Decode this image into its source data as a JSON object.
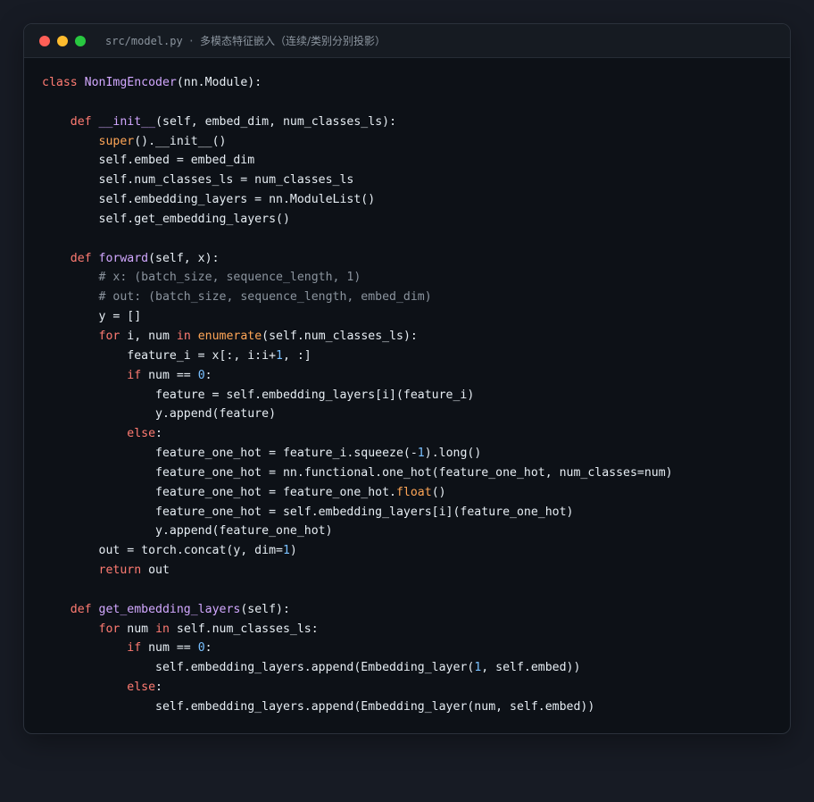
{
  "window": {
    "title_path": "src/model.py",
    "title_separator": "·",
    "title_desc": "多模态特征嵌入（连续/类别分别投影）",
    "traffic_lights": [
      {
        "name": "close",
        "color": "#ff5f57"
      },
      {
        "name": "minimize",
        "color": "#febc2e"
      },
      {
        "name": "maximize",
        "color": "#28c840"
      }
    ]
  },
  "colors": {
    "background": "#0d1117",
    "keyword": "#ff7b72",
    "class_name": "#d2a8ff",
    "function_name": "#d2a8ff",
    "builtin": "#ffa657",
    "number": "#79c0ff",
    "comment": "#8b949e",
    "text": "#e6edf3"
  },
  "code_lines": [
    [
      [
        "kw",
        "class "
      ],
      [
        "cls",
        "NonImgEncoder"
      ],
      [
        "",
        "(nn.Module):"
      ]
    ],
    [],
    [
      [
        "",
        "    "
      ],
      [
        "kw",
        "def "
      ],
      [
        "fn",
        "__init__"
      ],
      [
        "",
        "(self, embed_dim, num_classes_ls):"
      ]
    ],
    [
      [
        "",
        "        "
      ],
      [
        "bi",
        "super"
      ],
      [
        "",
        "().__init__()"
      ]
    ],
    [
      [
        "",
        "        self.embed = embed_dim"
      ]
    ],
    [
      [
        "",
        "        self.num_classes_ls = num_classes_ls"
      ]
    ],
    [
      [
        "",
        "        self.embedding_layers = nn.ModuleList()"
      ]
    ],
    [
      [
        "",
        "        self.get_embedding_layers()"
      ]
    ],
    [],
    [
      [
        "",
        "    "
      ],
      [
        "kw",
        "def "
      ],
      [
        "fn",
        "forward"
      ],
      [
        "",
        "(self, x):"
      ]
    ],
    [
      [
        "",
        "        "
      ],
      [
        "cm",
        "# x: (batch_size, sequence_length, 1)"
      ]
    ],
    [
      [
        "",
        "        "
      ],
      [
        "cm",
        "# out: (batch_size, sequence_length, embed_dim)"
      ]
    ],
    [
      [
        "",
        "        y = []"
      ]
    ],
    [
      [
        "",
        "        "
      ],
      [
        "kw",
        "for "
      ],
      [
        "",
        "i, num "
      ],
      [
        "kw",
        "in "
      ],
      [
        "bi",
        "enumerate"
      ],
      [
        "",
        "(self.num_classes_ls):"
      ]
    ],
    [
      [
        "",
        "            feature_i = x[:, i:i+"
      ],
      [
        "num",
        "1"
      ],
      [
        "",
        ", :]"
      ]
    ],
    [
      [
        "",
        "            "
      ],
      [
        "kw",
        "if "
      ],
      [
        "",
        "num == "
      ],
      [
        "num",
        "0"
      ],
      [
        "",
        ":"
      ]
    ],
    [
      [
        "",
        "                feature = self.embedding_layers[i](feature_i)"
      ]
    ],
    [
      [
        "",
        "                y.append(feature)"
      ]
    ],
    [
      [
        "",
        "            "
      ],
      [
        "kw",
        "else"
      ],
      [
        "",
        ":"
      ]
    ],
    [
      [
        "",
        "                feature_one_hot = feature_i.squeeze(-"
      ],
      [
        "num",
        "1"
      ],
      [
        "",
        ").long()"
      ]
    ],
    [
      [
        "",
        "                feature_one_hot = nn.functional.one_hot(feature_one_hot, num_classes=num)"
      ]
    ],
    [
      [
        "",
        "                feature_one_hot = feature_one_hot."
      ],
      [
        "bi",
        "float"
      ],
      [
        "",
        "()"
      ]
    ],
    [
      [
        "",
        "                feature_one_hot = self.embedding_layers[i](feature_one_hot)"
      ]
    ],
    [
      [
        "",
        "                y.append(feature_one_hot)"
      ]
    ],
    [
      [
        "",
        "        out = torch.concat(y, dim="
      ],
      [
        "num",
        "1"
      ],
      [
        "",
        ")"
      ]
    ],
    [
      [
        "",
        "        "
      ],
      [
        "kw",
        "return "
      ],
      [
        "",
        "out"
      ]
    ],
    [],
    [
      [
        "",
        "    "
      ],
      [
        "kw",
        "def "
      ],
      [
        "fn",
        "get_embedding_layers"
      ],
      [
        "",
        "(self):"
      ]
    ],
    [
      [
        "",
        "        "
      ],
      [
        "kw",
        "for "
      ],
      [
        "",
        "num "
      ],
      [
        "kw",
        "in "
      ],
      [
        "",
        "self.num_classes_ls:"
      ]
    ],
    [
      [
        "",
        "            "
      ],
      [
        "kw",
        "if "
      ],
      [
        "",
        "num == "
      ],
      [
        "num",
        "0"
      ],
      [
        "",
        ":"
      ]
    ],
    [
      [
        "",
        "                self.embedding_layers.append(Embedding_layer("
      ],
      [
        "num",
        "1"
      ],
      [
        "",
        ", self.embed))"
      ]
    ],
    [
      [
        "",
        "            "
      ],
      [
        "kw",
        "else"
      ],
      [
        "",
        ":"
      ]
    ],
    [
      [
        "",
        "                self.embedding_layers.append(Embedding_layer(num, self.embed))"
      ]
    ]
  ]
}
